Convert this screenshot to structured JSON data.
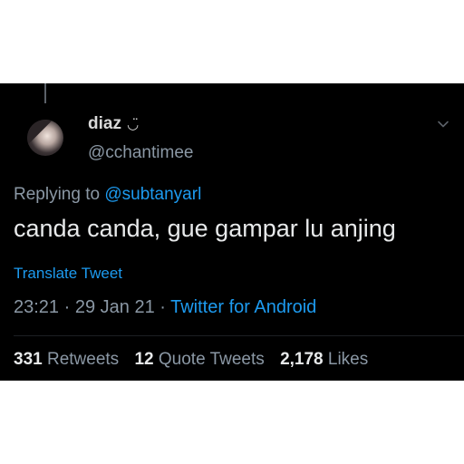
{
  "tweet": {
    "author": {
      "display_name": "diaz",
      "name_emoji": "◡̈",
      "handle": "@cchantimee",
      "avatar_icon": "avatar-photo"
    },
    "reply": {
      "prefix": "Replying to ",
      "mention": "@subtanyarl"
    },
    "text": "canda canda, gue gampar lu anjing",
    "translate_label": "Translate Tweet",
    "meta": {
      "time": "23:21",
      "separator": " · ",
      "date": "29 Jan 21",
      "source": "Twitter for Android"
    },
    "stats": {
      "retweets_count": "331",
      "retweets_label": "Retweets",
      "quotes_count": "12",
      "quotes_label": "Quote Tweets",
      "likes_count": "2,178",
      "likes_label": "Likes"
    },
    "menu_icon": "chevron-down-icon"
  },
  "colors": {
    "background": "#000000",
    "text": "#e7e9ea",
    "secondary": "#8b98a5",
    "accent": "#1d9bf0"
  }
}
